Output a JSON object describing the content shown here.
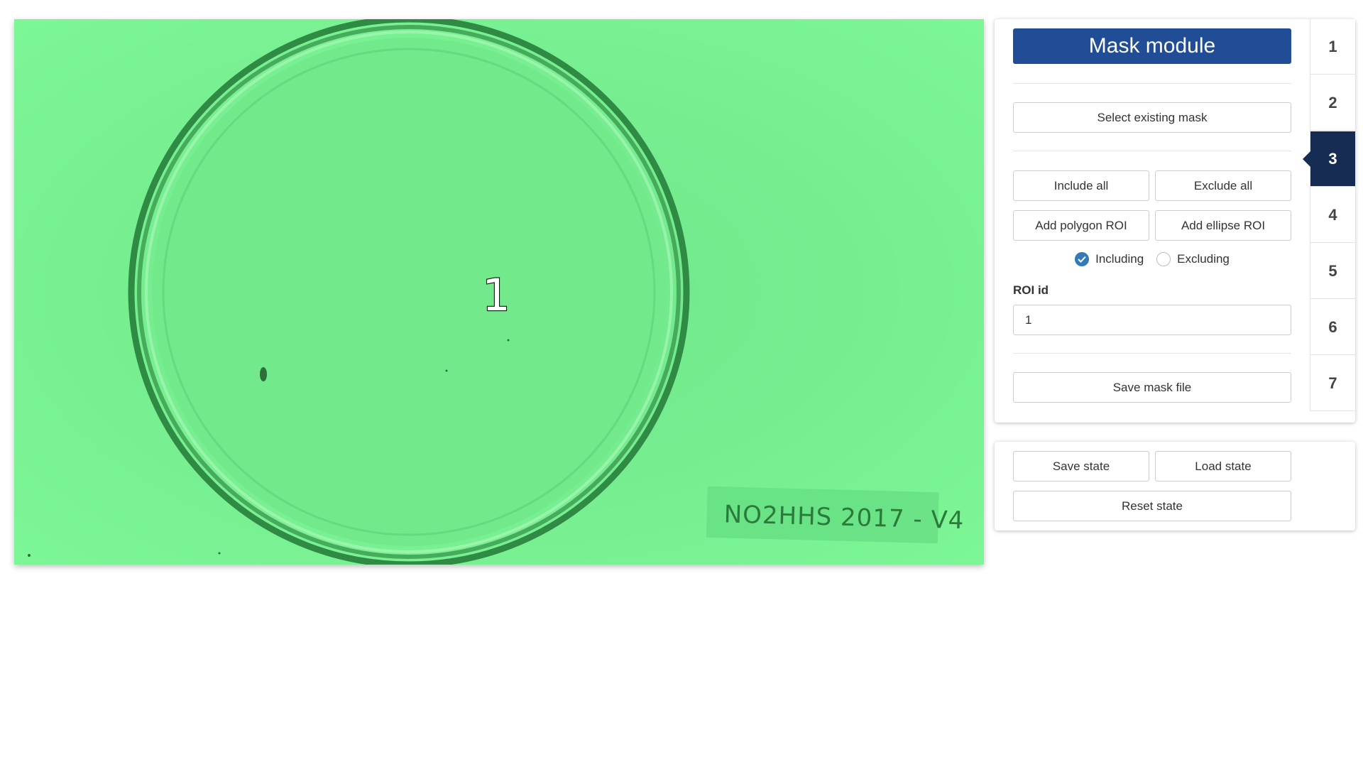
{
  "viewer": {
    "roi_label": "1",
    "plate_label": "NO2HHS 2017 - V4",
    "overlay_color": "#7cf594",
    "rim_color": "#2f8a43"
  },
  "mask_module": {
    "title": "Mask module",
    "select_existing_mask": "Select existing mask",
    "include_all": "Include all",
    "exclude_all": "Exclude all",
    "add_polygon_roi": "Add polygon ROI",
    "add_ellipse_roi": "Add ellipse ROI",
    "radio_including": "Including",
    "radio_excluding": "Excluding",
    "selected_mode": "Including",
    "roi_id_label": "ROI id",
    "roi_id_value": "1",
    "save_mask_file": "Save mask file",
    "title_color": "#214d96"
  },
  "state": {
    "save_state": "Save state",
    "load_state": "Load state",
    "reset_state": "Reset state"
  },
  "steps": {
    "items": [
      "1",
      "2",
      "3",
      "4",
      "5",
      "6",
      "7"
    ],
    "active": "3",
    "active_color": "#172c52"
  }
}
